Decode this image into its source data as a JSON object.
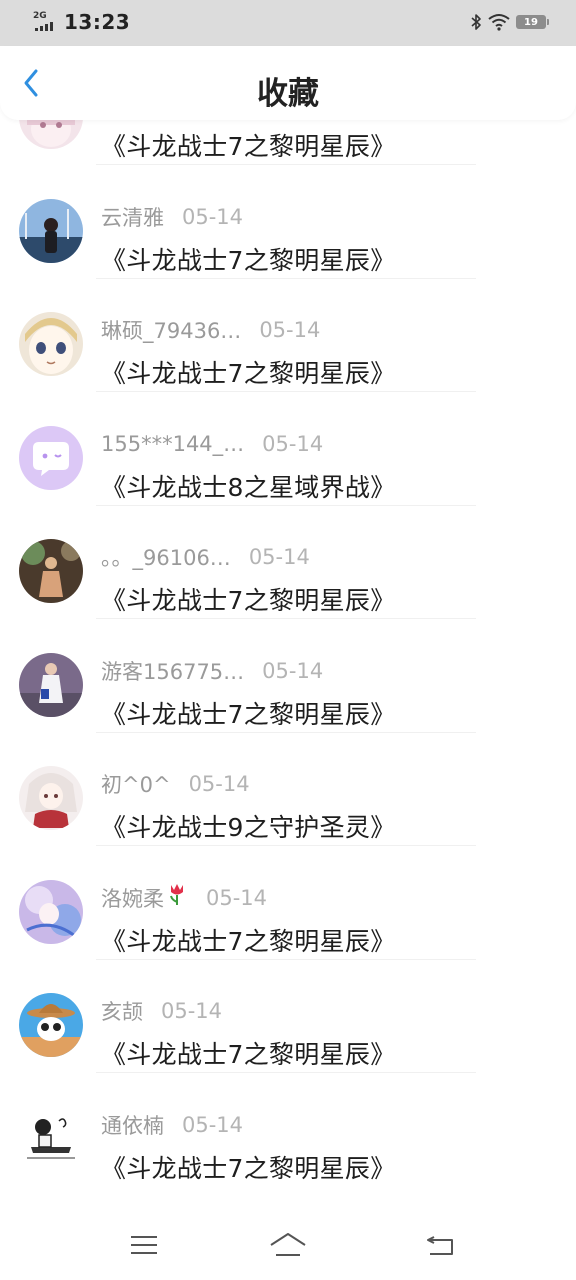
{
  "status_bar": {
    "network": "2G",
    "time": "13:23",
    "battery": "19",
    "icons": [
      "signal-icon",
      "bluetooth-icon",
      "wifi-icon",
      "battery-icon"
    ]
  },
  "header": {
    "title": "收藏",
    "back_icon": "chevron-left-icon"
  },
  "items": [
    {
      "user": "",
      "date": "",
      "title": "《斗龙战士7之黎明星辰》"
    },
    {
      "user": "云清雅",
      "date": "05-14",
      "title": "《斗龙战士7之黎明星辰》"
    },
    {
      "user": "琳硕_79436…",
      "date": "05-14",
      "title": "《斗龙战士7之黎明星辰》"
    },
    {
      "user": "155***144_…",
      "date": "05-14",
      "title": "《斗龙战士8之星域界战》"
    },
    {
      "user": "。。_96106…",
      "date": "05-14",
      "title": "《斗龙战士7之黎明星辰》"
    },
    {
      "user": "游客156775…",
      "date": "05-14",
      "title": "《斗龙战士7之黎明星辰》"
    },
    {
      "user": "初^0^",
      "date": "05-14",
      "title": "《斗龙战士9之守护圣灵》"
    },
    {
      "user": "洛婉柔",
      "date": "05-14",
      "title": "《斗龙战士7之黎明星辰》"
    },
    {
      "user": "亥颉",
      "date": "05-14",
      "title": "《斗龙战士7之黎明星辰》"
    },
    {
      "user": "通依楠",
      "date": "05-14",
      "title": "《斗龙战士7之黎明星辰》"
    }
  ],
  "bottom_nav": {
    "icons": [
      "menu-icon",
      "home-icon",
      "back-icon"
    ]
  },
  "colors": {
    "status_bar_bg": "#dcdcdc",
    "accent": "#2f8fe0",
    "username": "#9a9a9a",
    "title_text": "#1e1e1e"
  }
}
